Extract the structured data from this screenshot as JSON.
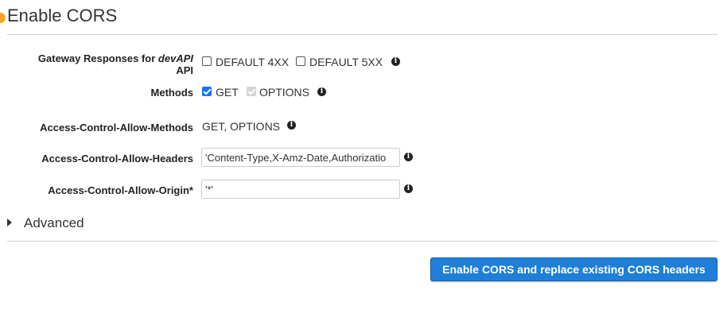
{
  "panel": {
    "title": "Enable CORS"
  },
  "gateway_responses": {
    "label_prefix": "Gateway Responses for",
    "api_name": "devAPI",
    "label_suffix": "API",
    "options": [
      {
        "label": "DEFAULT 4XX",
        "checked": false
      },
      {
        "label": "DEFAULT 5XX",
        "checked": false
      }
    ]
  },
  "methods": {
    "label": "Methods",
    "options": [
      {
        "label": "GET",
        "checked": true,
        "disabled": false
      },
      {
        "label": "OPTIONS",
        "checked": true,
        "disabled": true
      }
    ]
  },
  "allow_methods": {
    "label": "Access-Control-Allow-Methods",
    "value": "GET, OPTIONS"
  },
  "allow_headers": {
    "label": "Access-Control-Allow-Headers",
    "value": "'Content-Type,X-Amz-Date,Authorizatio"
  },
  "allow_origin": {
    "label": "Access-Control-Allow-Origin*",
    "value": "'*'"
  },
  "advanced": {
    "label": "Advanced"
  },
  "actions": {
    "submit_label": "Enable CORS and replace existing CORS headers"
  },
  "info_icon_glyph": "i",
  "colors": {
    "primary_button": "#1f7fd8",
    "checkbox_checked": "#1a73e8",
    "status_dot": "#f5a623"
  }
}
